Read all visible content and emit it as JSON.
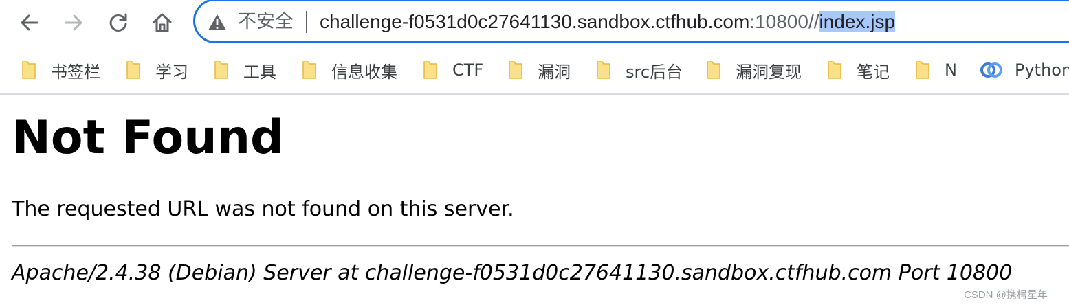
{
  "toolbar": {
    "back_icon": "arrow-left-icon",
    "forward_icon": "arrow-right-icon",
    "reload_icon": "reload-icon",
    "home_icon": "home-icon"
  },
  "omnibox": {
    "security_icon": "warning-triangle-icon",
    "security_text": "不安全",
    "url_host": "challenge-f0531d0c27641130.sandbox.ctfhub.com",
    "url_port": ":10800//",
    "url_selected": "index.jsp"
  },
  "bookmarks": [
    {
      "label": "书签栏",
      "icon": "folder-icon"
    },
    {
      "label": "学习",
      "icon": "folder-icon"
    },
    {
      "label": "工具",
      "icon": "folder-icon"
    },
    {
      "label": "信息收集",
      "icon": "folder-icon"
    },
    {
      "label": "CTF",
      "icon": "folder-icon"
    },
    {
      "label": "漏洞",
      "icon": "folder-icon"
    },
    {
      "label": "src后台",
      "icon": "folder-icon"
    },
    {
      "label": "漏洞复现",
      "icon": "folder-icon"
    },
    {
      "label": "笔记",
      "icon": "folder-icon"
    },
    {
      "label": "N",
      "icon": "folder-icon"
    },
    {
      "label": "Python",
      "icon": "python-logo-icon"
    }
  ],
  "page": {
    "title": "Not Found",
    "message": "The requested URL was not found on this server.",
    "footer": "Apache/2.4.38 (Debian) Server at challenge-f0531d0c27641130.sandbox.ctfhub.com Port 10800"
  },
  "watermark": "CSDN @携枵星年",
  "colors": {
    "omnibox_border": "#1a73e8",
    "selection": "#a8c7fa",
    "folder_fill": "#fbe08a",
    "folder_stroke": "#e8b93b"
  }
}
